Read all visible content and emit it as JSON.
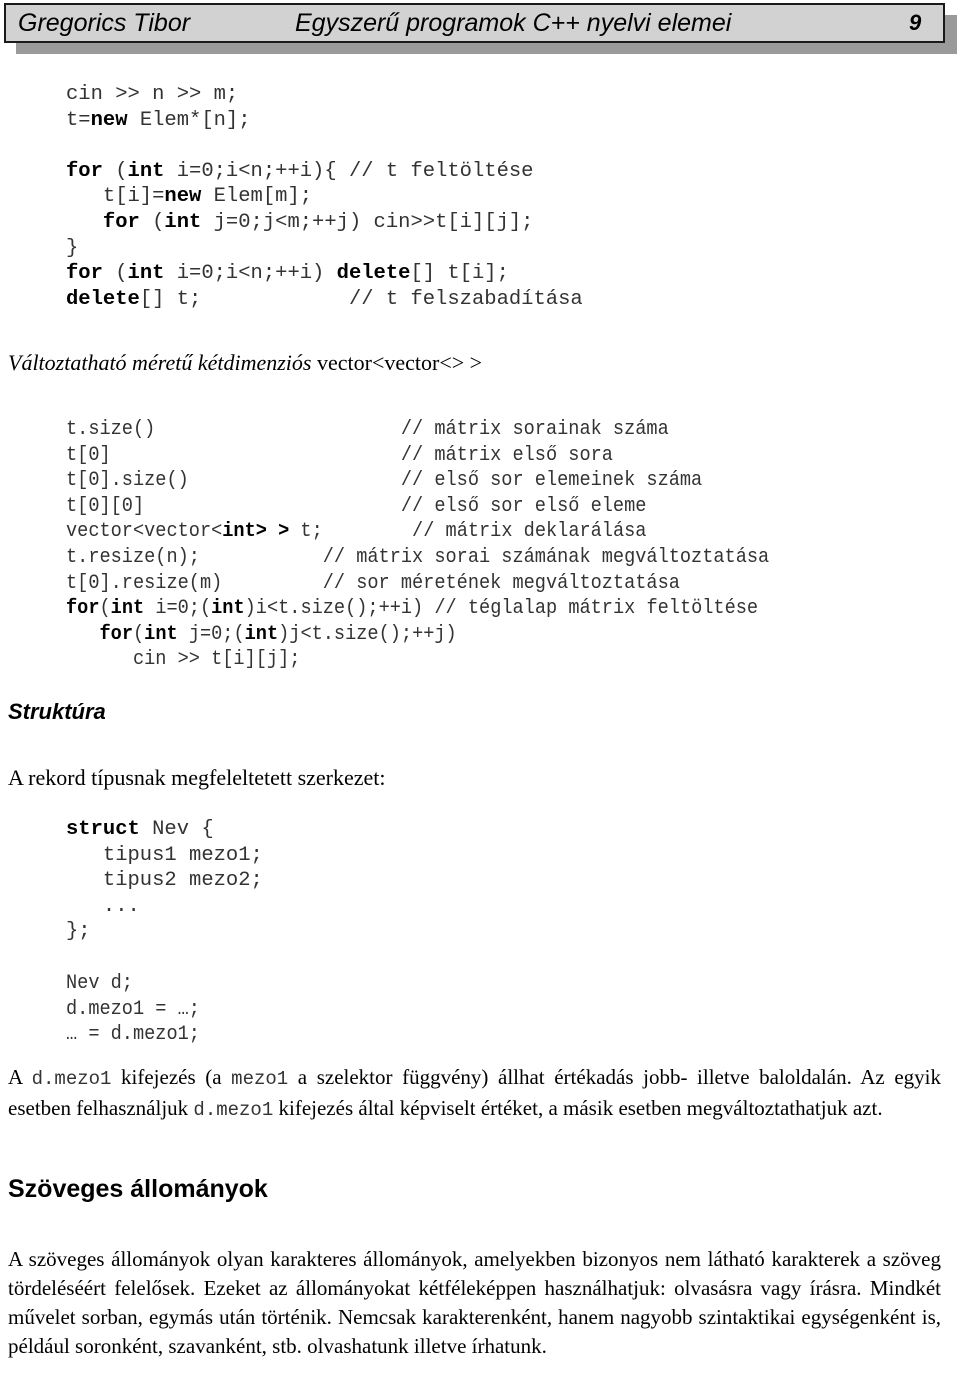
{
  "header": {
    "author": "Gregorics Tibor",
    "title": "Egyszerű programok C++ nyelvi elemei",
    "page_number": "9"
  },
  "code_block_1": {
    "lines": [
      [
        {
          "t": "cin >> n >> m;"
        }
      ],
      [
        {
          "t": "t="
        },
        {
          "t": "new",
          "b": true
        },
        {
          "t": " Elem*[n];"
        }
      ],
      [
        {
          "t": ""
        }
      ],
      [
        {
          "t": "for",
          "b": true
        },
        {
          "t": " ("
        },
        {
          "t": "int",
          "b": true
        },
        {
          "t": " i=0;i<n;++i){ // t feltöltése"
        }
      ],
      [
        {
          "t": "   t[i]="
        },
        {
          "t": "new",
          "b": true
        },
        {
          "t": " Elem[m];"
        }
      ],
      [
        {
          "t": "   "
        },
        {
          "t": "for",
          "b": true
        },
        {
          "t": " ("
        },
        {
          "t": "int",
          "b": true
        },
        {
          "t": " j=0;j<m;++j) cin>>t[i][j];"
        }
      ],
      [
        {
          "t": "}"
        }
      ],
      [
        {
          "t": "for",
          "b": true
        },
        {
          "t": " ("
        },
        {
          "t": "int",
          "b": true
        },
        {
          "t": " i=0;i<n;++i) "
        },
        {
          "t": "delete",
          "b": true
        },
        {
          "t": "[] t[i];"
        }
      ],
      [
        {
          "t": "delete",
          "b": true
        },
        {
          "t": "[] t;            // t felszabadítása"
        }
      ]
    ]
  },
  "subheading_vector": {
    "italic": "Változtatható méretű kétdimenziós",
    "normal": " vector<vector<> >"
  },
  "code_block_2": {
    "lines": [
      [
        {
          "t": "t.size()                      // mátrix sorainak száma"
        }
      ],
      [
        {
          "t": "t[0]                          // mátrix első sora"
        }
      ],
      [
        {
          "t": "t[0].size()                   // első sor elemeinek száma"
        }
      ],
      [
        {
          "t": "t[0][0]                       // első sor első eleme"
        }
      ],
      [
        {
          "t": "vector<vector<"
        },
        {
          "t": "int>",
          "b": true
        },
        {
          "t": " "
        },
        {
          "t": ">",
          "b": true
        },
        {
          "t": " t;        // mátrix deklarálása"
        }
      ],
      [
        {
          "t": "t.resize(n);           // mátrix sorai számának megváltoztatása"
        }
      ],
      [
        {
          "t": "t[0].resize(m)         // sor méretének megváltoztatása"
        }
      ],
      [
        {
          "t": "for",
          "b": true
        },
        {
          "t": "("
        },
        {
          "t": "int",
          "b": true
        },
        {
          "t": " i=0;("
        },
        {
          "t": "int",
          "b": true
        },
        {
          "t": ")i<t.size();++i) // téglalap mátrix feltöltése"
        }
      ],
      [
        {
          "t": "   "
        },
        {
          "t": "for",
          "b": true
        },
        {
          "t": "("
        },
        {
          "t": "int",
          "b": true
        },
        {
          "t": " j=0;("
        },
        {
          "t": "int",
          "b": true
        },
        {
          "t": ")j<t.size();++j)"
        }
      ],
      [
        {
          "t": "      cin >> t[i][j];"
        }
      ]
    ]
  },
  "section_struct": {
    "heading": "Struktúra",
    "lead": "A rekord típusnak megfeleltetett szerkezet:"
  },
  "code_block_3": {
    "lines": [
      [
        {
          "t": "struct",
          "b": true
        },
        {
          "t": " Nev {"
        }
      ],
      [
        {
          "t": "   tipus1 mezo1;"
        }
      ],
      [
        {
          "t": "   tipus2 mezo2;"
        }
      ],
      [
        {
          "t": "   ..."
        }
      ],
      [
        {
          "t": "};"
        }
      ]
    ]
  },
  "code_block_4": {
    "lines": [
      [
        {
          "t": "Nev d;"
        }
      ],
      [
        {
          "t": "d.mezo1 = …;"
        }
      ],
      [
        {
          "t": "… = d.mezo1;"
        }
      ]
    ]
  },
  "paragraph_struct": [
    {
      "t": "A "
    },
    {
      "t": "d.mezo1",
      "m": true
    },
    {
      "t": " kifejezés (a "
    },
    {
      "t": "mezo1",
      "m": true
    },
    {
      "t": " a szelektor függvény) állhat értékadás jobb- illetve baloldalán. Az egyik esetben felhasználjuk "
    },
    {
      "t": "d.mezo1",
      "m": true
    },
    {
      "t": " kifejezés által képviselt értéket, a másik esetben megváltoztathatjuk azt."
    }
  ],
  "section_text_files": {
    "heading": "Szöveges állományok",
    "paragraph": "A szöveges állományok olyan karakteres állományok, amelyekben bizonyos nem látható karakterek a szöveg tördeléséért felelősek. Ezeket az állományokat kétféleképpen használhatjuk: olvasásra vagy írásra. Mindkét művelet sorban, egymás után történik. Nemcsak karakterenként, hanem nagyobb szintaktikai egységenként is, például soronként, szavanként, stb.  olvashatunk illetve írhatunk."
  },
  "colors": {
    "header_fill": "#d2d2d2",
    "header_shadow": "#9a9a9a",
    "code_text": "#333333",
    "text": "#000000"
  }
}
